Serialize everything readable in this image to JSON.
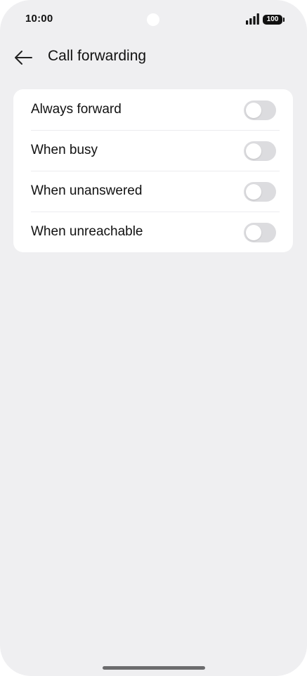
{
  "status_bar": {
    "time": "10:00",
    "battery_level": "100",
    "icons": [
      "signal-icon",
      "battery-icon"
    ]
  },
  "header": {
    "title": "Call forwarding",
    "back_icon": "arrow-left-icon"
  },
  "settings": [
    {
      "label": "Always forward",
      "enabled": false
    },
    {
      "label": "When busy",
      "enabled": false
    },
    {
      "label": "When unanswered",
      "enabled": false
    },
    {
      "label": "When unreachable",
      "enabled": false
    }
  ],
  "colors": {
    "background": "#efeff1",
    "card": "#ffffff",
    "toggle_off": "#dcdcdf",
    "text": "#111111"
  }
}
